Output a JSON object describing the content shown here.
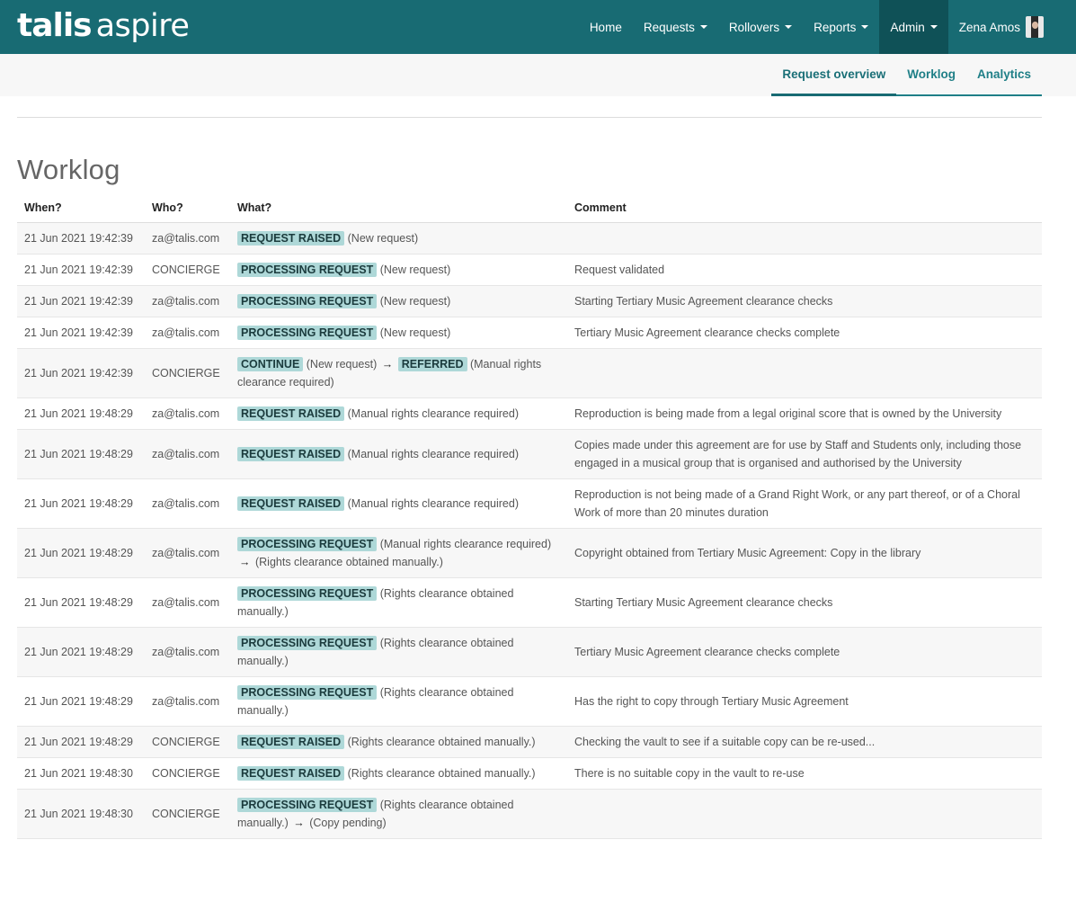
{
  "brand": {
    "part1": "talis",
    "part2": "aspire"
  },
  "nav": {
    "items": [
      {
        "name": "nav-home",
        "label": "Home",
        "caret": false,
        "active": false
      },
      {
        "name": "nav-requests",
        "label": "Requests",
        "caret": true,
        "active": false
      },
      {
        "name": "nav-rollovers",
        "label": "Rollovers",
        "caret": true,
        "active": false
      },
      {
        "name": "nav-reports",
        "label": "Reports",
        "caret": true,
        "active": false
      },
      {
        "name": "nav-admin",
        "label": "Admin",
        "caret": true,
        "active": true
      }
    ],
    "user": "Zena Amos"
  },
  "subnav": {
    "tabs": [
      {
        "name": "tab-request-overview",
        "label": "Request overview",
        "active": true
      },
      {
        "name": "tab-worklog",
        "label": "Worklog",
        "active": false
      },
      {
        "name": "tab-analytics",
        "label": "Analytics",
        "active": false
      }
    ]
  },
  "page": {
    "title": "Worklog"
  },
  "table": {
    "headers": [
      "When?",
      "Who?",
      "What?",
      "Comment"
    ],
    "rows": [
      {
        "when": "21 Jun 2021 19:42:39",
        "who": "za@talis.com",
        "what": [
          {
            "badge": "REQUEST RAISED",
            "text": "(New request)"
          }
        ],
        "comment": ""
      },
      {
        "when": "21 Jun 2021 19:42:39",
        "who": "CONCIERGE",
        "what": [
          {
            "badge": "PROCESSING REQUEST",
            "text": "(New request)"
          }
        ],
        "comment": "Request validated"
      },
      {
        "when": "21 Jun 2021 19:42:39",
        "who": "za@talis.com",
        "what": [
          {
            "badge": "PROCESSING REQUEST",
            "text": "(New request)"
          }
        ],
        "comment": "Starting Tertiary Music Agreement clearance checks"
      },
      {
        "when": "21 Jun 2021 19:42:39",
        "who": "za@talis.com",
        "what": [
          {
            "badge": "PROCESSING REQUEST",
            "text": "(New request)"
          }
        ],
        "comment": "Tertiary Music Agreement clearance checks complete"
      },
      {
        "when": "21 Jun 2021 19:42:39",
        "who": "CONCIERGE",
        "what": [
          {
            "badge": "CONTINUE",
            "text": "(New request)"
          },
          {
            "badge": "REFERRED",
            "text": "(Manual rights clearance required)"
          }
        ],
        "comment": ""
      },
      {
        "when": "21 Jun 2021 19:48:29",
        "who": "za@talis.com",
        "what": [
          {
            "badge": "REQUEST RAISED",
            "text": "(Manual rights clearance required)"
          }
        ],
        "comment": "Reproduction is being made from a legal original score that is owned by the University"
      },
      {
        "when": "21 Jun 2021 19:48:29",
        "who": "za@talis.com",
        "what": [
          {
            "badge": "REQUEST RAISED",
            "text": "(Manual rights clearance required)"
          }
        ],
        "comment": "Copies made under this agreement are for use by Staff and Students only, including those engaged in a musical group that is organised and authorised by the University"
      },
      {
        "when": "21 Jun 2021 19:48:29",
        "who": "za@talis.com",
        "what": [
          {
            "badge": "REQUEST RAISED",
            "text": "(Manual rights clearance required)"
          }
        ],
        "comment": "Reproduction is not being made of a Grand Right Work, or any part thereof, or of a Choral Work of more than 20 minutes duration"
      },
      {
        "when": "21 Jun 2021 19:48:29",
        "who": "za@talis.com",
        "what": [
          {
            "badge": "PROCESSING REQUEST",
            "text": "(Manual rights clearance required)"
          },
          {
            "badge": "",
            "text": "(Rights clearance obtained manually.)"
          }
        ],
        "comment": "Copyright obtained from Tertiary Music Agreement: Copy in the library"
      },
      {
        "when": "21 Jun 2021 19:48:29",
        "who": "za@talis.com",
        "what": [
          {
            "badge": "PROCESSING REQUEST",
            "text": "(Rights clearance obtained manually.)"
          }
        ],
        "comment": "Starting Tertiary Music Agreement clearance checks"
      },
      {
        "when": "21 Jun 2021 19:48:29",
        "who": "za@talis.com",
        "what": [
          {
            "badge": "PROCESSING REQUEST",
            "text": "(Rights clearance obtained manually.)"
          }
        ],
        "comment": "Tertiary Music Agreement clearance checks complete"
      },
      {
        "when": "21 Jun 2021 19:48:29",
        "who": "za@talis.com",
        "what": [
          {
            "badge": "PROCESSING REQUEST",
            "text": "(Rights clearance obtained manually.)"
          }
        ],
        "comment": "Has the right to copy through Tertiary Music Agreement"
      },
      {
        "when": "21 Jun 2021 19:48:29",
        "who": "CONCIERGE",
        "what": [
          {
            "badge": "REQUEST RAISED",
            "text": "(Rights clearance obtained manually.)"
          }
        ],
        "comment": "Checking the vault to see if a suitable copy can be re-used..."
      },
      {
        "when": "21 Jun 2021 19:48:30",
        "who": "CONCIERGE",
        "what": [
          {
            "badge": "REQUEST RAISED",
            "text": "(Rights clearance obtained manually.)"
          }
        ],
        "comment": "There is no suitable copy in the vault to re-use"
      },
      {
        "when": "21 Jun 2021 19:48:30",
        "who": "CONCIERGE",
        "what": [
          {
            "badge": "PROCESSING REQUEST",
            "text": "(Rights clearance obtained manually.)"
          },
          {
            "badge": "",
            "text": "(Copy pending)"
          }
        ],
        "comment": ""
      }
    ]
  }
}
